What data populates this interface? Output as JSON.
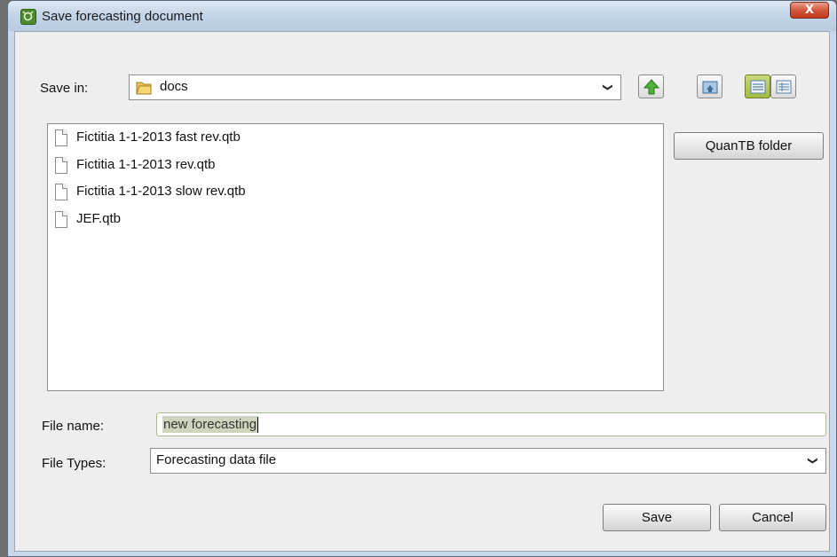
{
  "window": {
    "title": "Save forecasting document",
    "close_label": "X"
  },
  "save_in": {
    "label": "Save in:",
    "value": "docs"
  },
  "toolbar": {
    "icons": [
      "up-folder-icon",
      "home-folder-icon",
      "list-view-icon",
      "details-view-icon"
    ],
    "active_view": "list"
  },
  "files": [
    {
      "name": "Fictitia 1-1-2013 fast rev.qtb"
    },
    {
      "name": "Fictitia 1-1-2013 rev.qtb"
    },
    {
      "name": "Fictitia 1-1-2013 slow rev.qtb"
    },
    {
      "name": "JEF.qtb"
    }
  ],
  "side_button": {
    "label": "QuanTB folder"
  },
  "file_name": {
    "label": "File name:",
    "value": "new forecasting"
  },
  "file_types": {
    "label": "File Types:",
    "value": "Forecasting data file"
  },
  "buttons": {
    "save": "Save",
    "cancel": "Cancel"
  },
  "colors": {
    "titlebar": "#c4d5e8",
    "close": "#c9432a",
    "active_toggle": "#b1c757",
    "up_arrow": "#3f9a2c"
  }
}
